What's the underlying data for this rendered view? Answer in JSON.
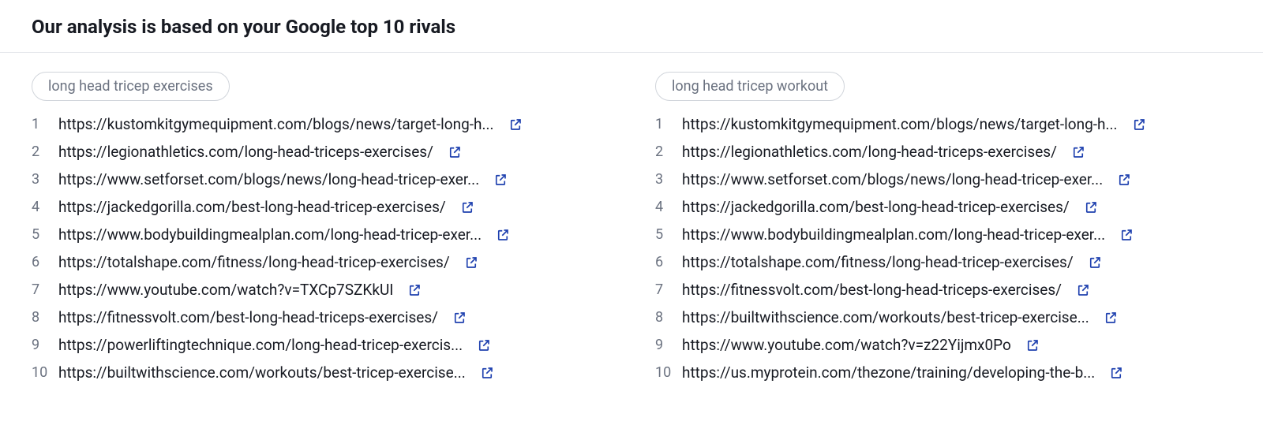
{
  "header": {
    "title": "Our analysis is based on your Google top 10 rivals"
  },
  "columns": [
    {
      "keyword": "long head tricep exercises",
      "results": [
        {
          "rank": "1",
          "url": "https://kustomkitgymequipment.com/blogs/news/target-long-h..."
        },
        {
          "rank": "2",
          "url": "https://legionathletics.com/long-head-triceps-exercises/"
        },
        {
          "rank": "3",
          "url": "https://www.setforset.com/blogs/news/long-head-tricep-exer..."
        },
        {
          "rank": "4",
          "url": "https://jackedgorilla.com/best-long-head-tricep-exercises/"
        },
        {
          "rank": "5",
          "url": "https://www.bodybuildingmealplan.com/long-head-tricep-exer..."
        },
        {
          "rank": "6",
          "url": "https://totalshape.com/fitness/long-head-tricep-exercises/"
        },
        {
          "rank": "7",
          "url": "https://www.youtube.com/watch?v=TXCp7SZKkUI"
        },
        {
          "rank": "8",
          "url": "https://fitnessvolt.com/best-long-head-triceps-exercises/"
        },
        {
          "rank": "9",
          "url": "https://powerliftingtechnique.com/long-head-tricep-exercis..."
        },
        {
          "rank": "10",
          "url": "https://builtwithscience.com/workouts/best-tricep-exercise..."
        }
      ]
    },
    {
      "keyword": "long head tricep workout",
      "results": [
        {
          "rank": "1",
          "url": "https://kustomkitgymequipment.com/blogs/news/target-long-h..."
        },
        {
          "rank": "2",
          "url": "https://legionathletics.com/long-head-triceps-exercises/"
        },
        {
          "rank": "3",
          "url": "https://www.setforset.com/blogs/news/long-head-tricep-exer..."
        },
        {
          "rank": "4",
          "url": "https://jackedgorilla.com/best-long-head-tricep-exercises/"
        },
        {
          "rank": "5",
          "url": "https://www.bodybuildingmealplan.com/long-head-tricep-exer..."
        },
        {
          "rank": "6",
          "url": "https://totalshape.com/fitness/long-head-tricep-exercises/"
        },
        {
          "rank": "7",
          "url": "https://fitnessvolt.com/best-long-head-triceps-exercises/"
        },
        {
          "rank": "8",
          "url": "https://builtwithscience.com/workouts/best-tricep-exercise..."
        },
        {
          "rank": "9",
          "url": "https://www.youtube.com/watch?v=z22Yijmx0Po"
        },
        {
          "rank": "10",
          "url": "https://us.myprotein.com/thezone/training/developing-the-b..."
        }
      ]
    }
  ]
}
